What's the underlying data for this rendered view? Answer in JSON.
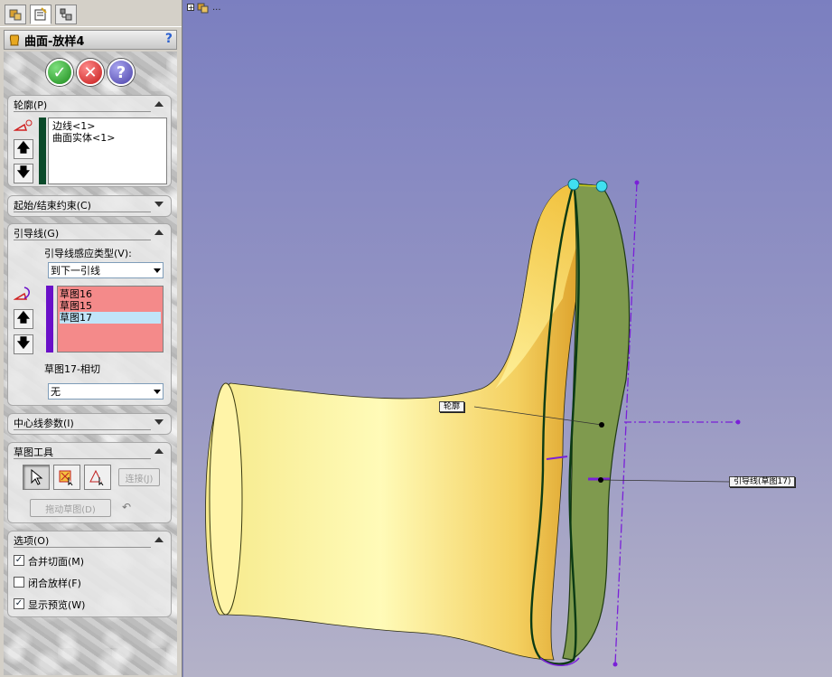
{
  "feature": {
    "title": "曲面-放样4",
    "help": "?"
  },
  "confirm": {
    "ok": "✓",
    "cancel": "✕",
    "help": "?"
  },
  "profiles": {
    "header": "轮廓(P)",
    "items": [
      "边线<1>",
      "曲面实体<1>"
    ]
  },
  "constraints": {
    "header": "起始/结束约束(C)"
  },
  "guides": {
    "header": "引导线(G)",
    "influence_label": "引导线感应类型(V):",
    "influence_value": "到下一引线",
    "items": [
      "草图16",
      "草图15",
      "草图17"
    ],
    "tangency_label": "草图17-相切",
    "tangency_value": "无"
  },
  "centerline": {
    "header": "中心线参数(I)"
  },
  "sketch_tools": {
    "header": "草图工具",
    "connect": "连接(J)",
    "drag_sketch": "拖动草图(D)"
  },
  "options": {
    "header": "选项(O)",
    "merge_tangent": {
      "label": "合并切面(M)",
      "checked": "✓"
    },
    "close_loft": {
      "label": "闭合放样(F)",
      "checked": ""
    },
    "show_preview": {
      "label": "显示预览(W)",
      "checked": "✓"
    }
  },
  "viewport": {
    "tree_label": "...",
    "callout_profile": "轮廓",
    "callout_guide": "引导线(草图17)"
  },
  "colors": {
    "profile_bar": "#0b4a2a",
    "guide_bar": "#6a10c8",
    "list_selected": "#c0e4f8",
    "list_guides": "#f48a8a"
  }
}
